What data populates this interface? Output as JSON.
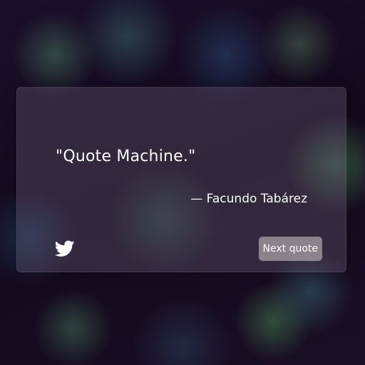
{
  "quote": {
    "text": "\"Quote Machine.\"",
    "author": "— Facundo Tabárez"
  },
  "actions": {
    "tweet_icon": "twitter-bird-icon",
    "next_label": "Next quote"
  },
  "colors": {
    "background": "#150a20",
    "text": "#ffffff",
    "button_bg": "#aaa0a5"
  }
}
